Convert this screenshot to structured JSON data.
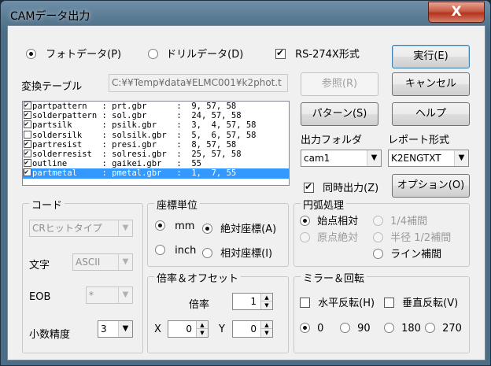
{
  "window": {
    "title": "CAMデータ出力",
    "close_glyph": "X"
  },
  "mode": {
    "photo_label": "フォトデータ(P)",
    "drill_label": "ドリルデータ(D)",
    "rs274x_label": "RS-274X形式"
  },
  "conversion_table": {
    "label": "変換テーブル",
    "path": "C:¥¥Temp¥data¥ELMC001¥k2phot.t"
  },
  "layers": [
    {
      "name": "partpattern  ",
      "file": "prt.gbr     ",
      "codes": "9, 57, 58",
      "checked": true
    },
    {
      "name": "solderpattern",
      "file": "sol.gbr     ",
      "codes": "24, 57, 58",
      "checked": true
    },
    {
      "name": "partsilk     ",
      "file": "psilk.gbr   ",
      "codes": "3,  4, 57, 58",
      "checked": true
    },
    {
      "name": "soldersilk   ",
      "file": "solsilk.gbr ",
      "codes": "5,  6, 57, 58",
      "checked": false
    },
    {
      "name": "partresist   ",
      "file": "presi.gbr   ",
      "codes": "8, 57, 58",
      "checked": true
    },
    {
      "name": "solderresist ",
      "file": "solresi.gbr ",
      "codes": "25, 57, 58",
      "checked": true
    },
    {
      "name": "outline      ",
      "file": "gaikei.gbr  ",
      "codes": "55",
      "checked": true
    },
    {
      "name": "partmetal    ",
      "file": "pmetal.gbr  ",
      "codes": "1,  7, 55",
      "checked": true
    }
  ],
  "buttons": {
    "execute": "実行(E)",
    "browse": "参照(R)",
    "cancel": "キャンセル",
    "pattern": "パターン(S)",
    "help": "ヘルプ",
    "options": "オプション(O)"
  },
  "output_folder": {
    "label": "出力フォルダ",
    "value": "cam1"
  },
  "report_format": {
    "label": "レポート形式",
    "value": "K2ENGTXT"
  },
  "simultaneous_output": {
    "label": "同時出力(Z)",
    "checked": true
  },
  "code_group": {
    "legend": "コード",
    "code_type": "CRヒットタイプ",
    "char_label": "文字",
    "char_value": "ASCII",
    "eob_label": "EOB",
    "eob_value": "*",
    "precision_label": "小数精度",
    "precision_value": "3"
  },
  "coord_unit_group": {
    "legend": "座標単位",
    "mm": "mm",
    "inch": "inch",
    "absolute": "絶対座標(A)",
    "relative": "相対座標(I)"
  },
  "arc_group": {
    "legend": "円弧処理",
    "start_relative": "始点相対",
    "quarter": "1/4補間",
    "origin_absolute": "原点絶対",
    "half_radius": "半径 1/2補間",
    "line": "ライン補間"
  },
  "scale_offset_group": {
    "legend": "倍率＆オフセット",
    "scale_label": "倍率",
    "scale_value": "1",
    "x_label": "X",
    "x_value": "0",
    "y_label": "Y",
    "y_value": "0"
  },
  "mirror_group": {
    "legend": "ミラー＆回転",
    "horizontal": "水平反転(H)",
    "vertical": "垂直反転(V)",
    "r0": "0",
    "r90": "90",
    "r180": "180",
    "r270": "270"
  }
}
